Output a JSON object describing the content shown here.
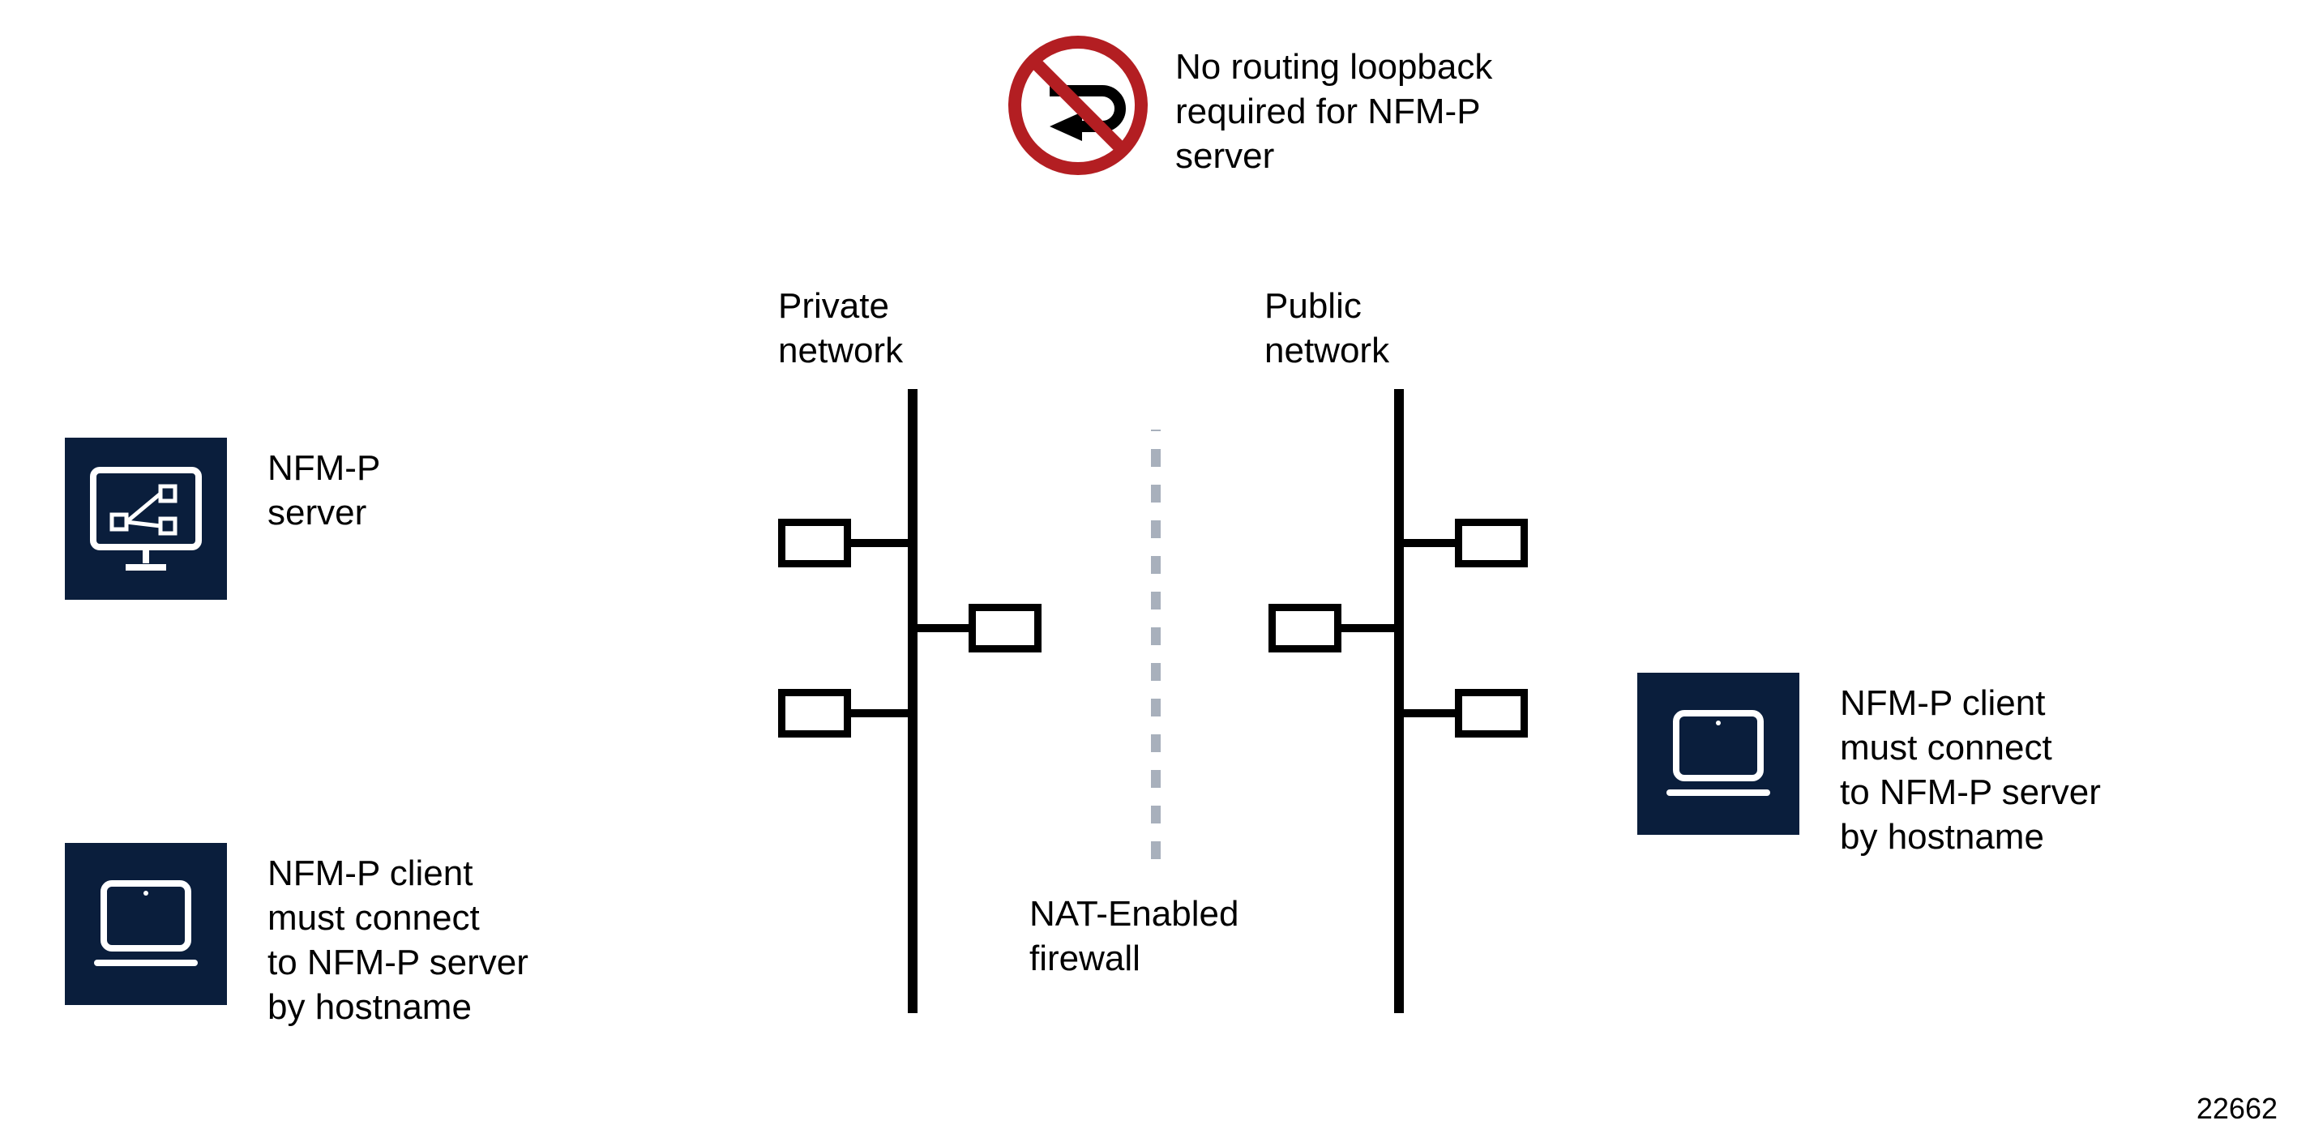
{
  "colors": {
    "tile_bg": "#0a1e3c",
    "prohibit_red": "#b31e22",
    "firewall_gray": "#a8b0bc"
  },
  "top_prohibit": {
    "text": "No routing loopback\nrequired for NFM-P\nserver"
  },
  "labels": {
    "private_network": "Private\nnetwork",
    "public_network": "Public\nnetwork",
    "nat_firewall": "NAT-Enabled\nfirewall"
  },
  "left": {
    "server_label": "NFM-P\nserver",
    "client_label": "NFM-P client\nmust connect\nto NFM-P server\nby hostname"
  },
  "right": {
    "client_label": "NFM-P client\nmust connect\nto NFM-P server\nby hostname"
  },
  "footer_id": "22662"
}
